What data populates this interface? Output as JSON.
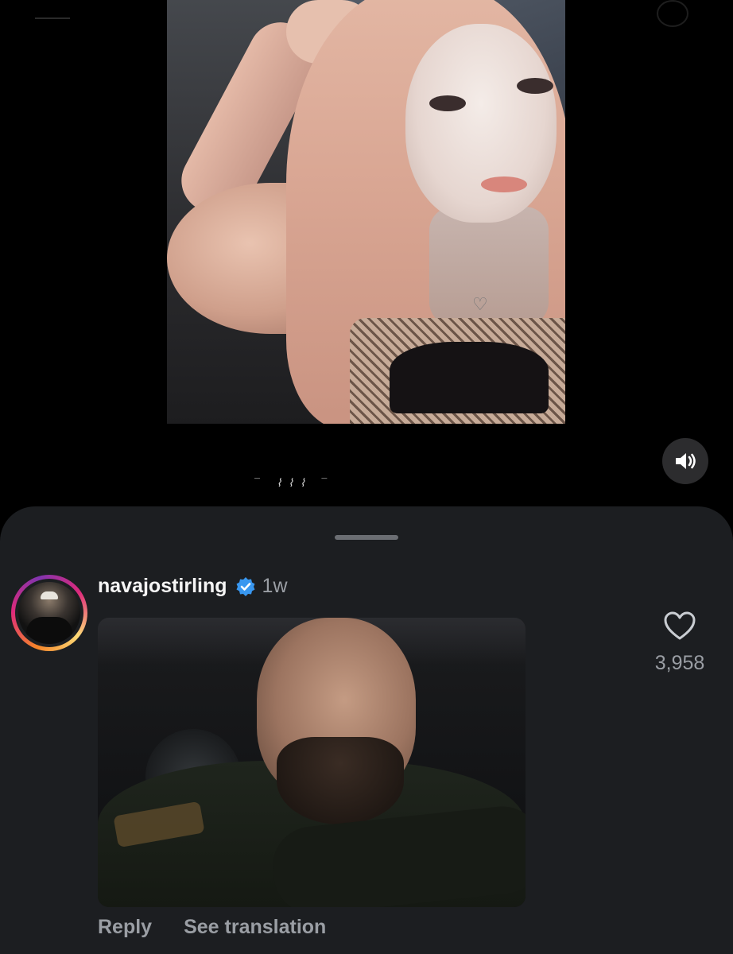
{
  "reel": {
    "sound_icon": "speaker-volume-icon"
  },
  "comment": {
    "username": "navajostirling",
    "verified_icon": "verified-badge-icon",
    "time": "1w",
    "like_icon": "heart-outline-icon",
    "like_count": "3,958",
    "reply_label": "Reply",
    "translate_label": "See translation"
  },
  "colors": {
    "background": "#000000",
    "sheet": "#1c1e21",
    "verified": "#3897f0",
    "muted_text": "#9a9ea4"
  }
}
